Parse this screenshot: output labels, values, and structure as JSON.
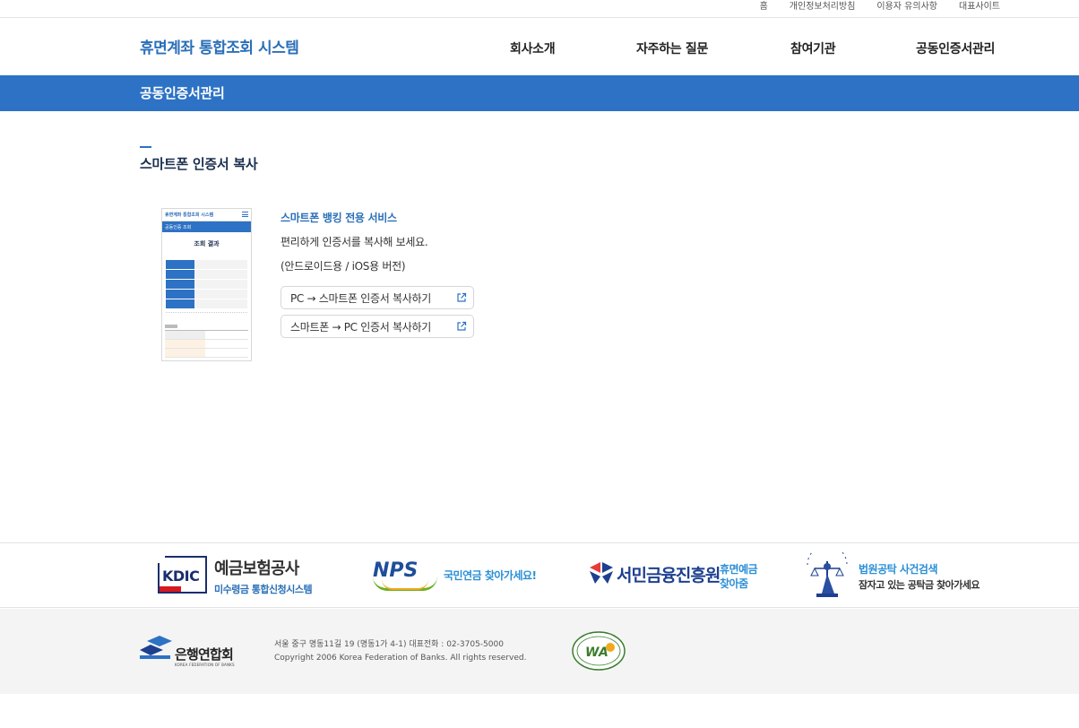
{
  "util_nav": [
    "홈",
    "개인정보처리방침",
    "이용자 유의사항",
    "대표사이트"
  ],
  "brand": "휴면계좌 통합조회 시스템",
  "gnb": [
    "회사소개",
    "자주하는 질문",
    "참여기관",
    "공동인증서관리"
  ],
  "section_banner": "공동인증서관리",
  "page_title": "스마트폰 인증서 복사",
  "phone_preview": {
    "header_title": "휴면계좌 통합조회 시스템",
    "band_title": "공동인증 조회",
    "result_title": "조회 결과"
  },
  "service": {
    "title": "스마트폰 뱅킹 전용 서비스",
    "desc": "편리하게 인증서를 복사해 보세요.",
    "note": "(안드로이드용 / iOS용 버전)",
    "buttons": [
      "PC → 스마트폰 인증서 복사하기",
      "스마트폰 → PC 인증서 복사하기"
    ]
  },
  "partners": {
    "kdic": {
      "logo": "KDIC",
      "name": "예금보험공사",
      "sub": "미수령금 통합신청시스템"
    },
    "nps": {
      "logo": "NPS",
      "text": "국민연금 찾아가세요!"
    },
    "kinfa": {
      "name": "서민금융진흥원",
      "line1": "휴면예금",
      "line2": "찾아줌"
    },
    "court": {
      "line1": "법원공탁 사건검색",
      "line2": "잠자고 있는 공탁금 찾아가세요"
    }
  },
  "footer": {
    "logo_name": "은행연합회",
    "logo_eng": "KOREA FEDERATION OF BANKS",
    "address": "서울 중구 명동11길 19 (명동1가 4-1)      대표전화 : 02-3705-5000",
    "copyright": "Copyright 2006 Korea Federation of Banks. All rights reserved."
  },
  "colors": {
    "primary": "#2d72c4",
    "brand_text": "#2a6fb8",
    "navy": "#1a2e4e"
  }
}
